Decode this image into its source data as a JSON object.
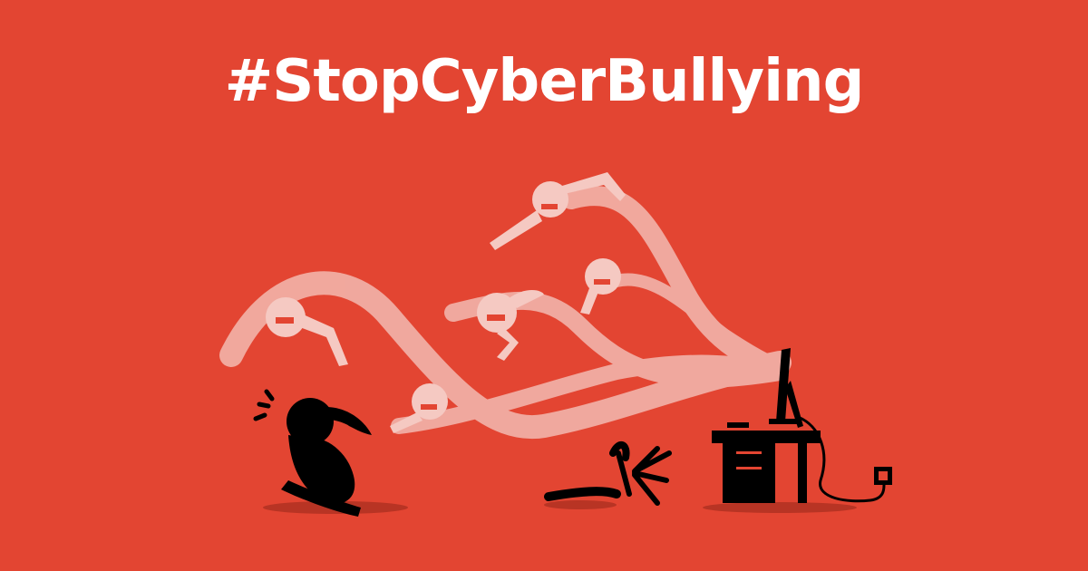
{
  "banner": {
    "headline": "#StopCyberBullying"
  },
  "colors": {
    "background": "#e34532",
    "headline": "#ffffff",
    "silhouette": "#000000",
    "ghost": "#f5c9c2"
  },
  "illustration": {
    "figures": [
      "victim",
      "ghost-bullies",
      "tipped-chair",
      "desk",
      "computer-monitor",
      "power-socket"
    ]
  }
}
